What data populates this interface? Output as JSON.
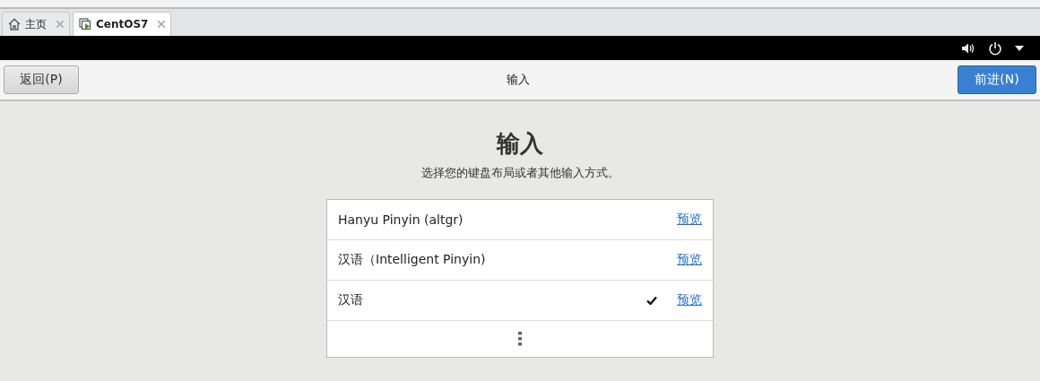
{
  "tabs": [
    {
      "label": "主页",
      "kind": "home",
      "selected": false
    },
    {
      "label": "CentOS7",
      "kind": "vm",
      "selected": true
    }
  ],
  "header": {
    "back_button": "返回(P)",
    "title": "输入",
    "next_button": "前进(N)"
  },
  "content": {
    "heading": "输入",
    "subtitle": "选择您的键盘布局或者其他输入方式。",
    "sources": [
      {
        "name": "Hanyu Pinyin (altgr)",
        "checked": false,
        "preview": "预览"
      },
      {
        "name": "汉语（Intelligent Pinyin)",
        "checked": false,
        "preview": "预览"
      },
      {
        "name": "汉语",
        "checked": true,
        "preview": "预览"
      }
    ]
  }
}
